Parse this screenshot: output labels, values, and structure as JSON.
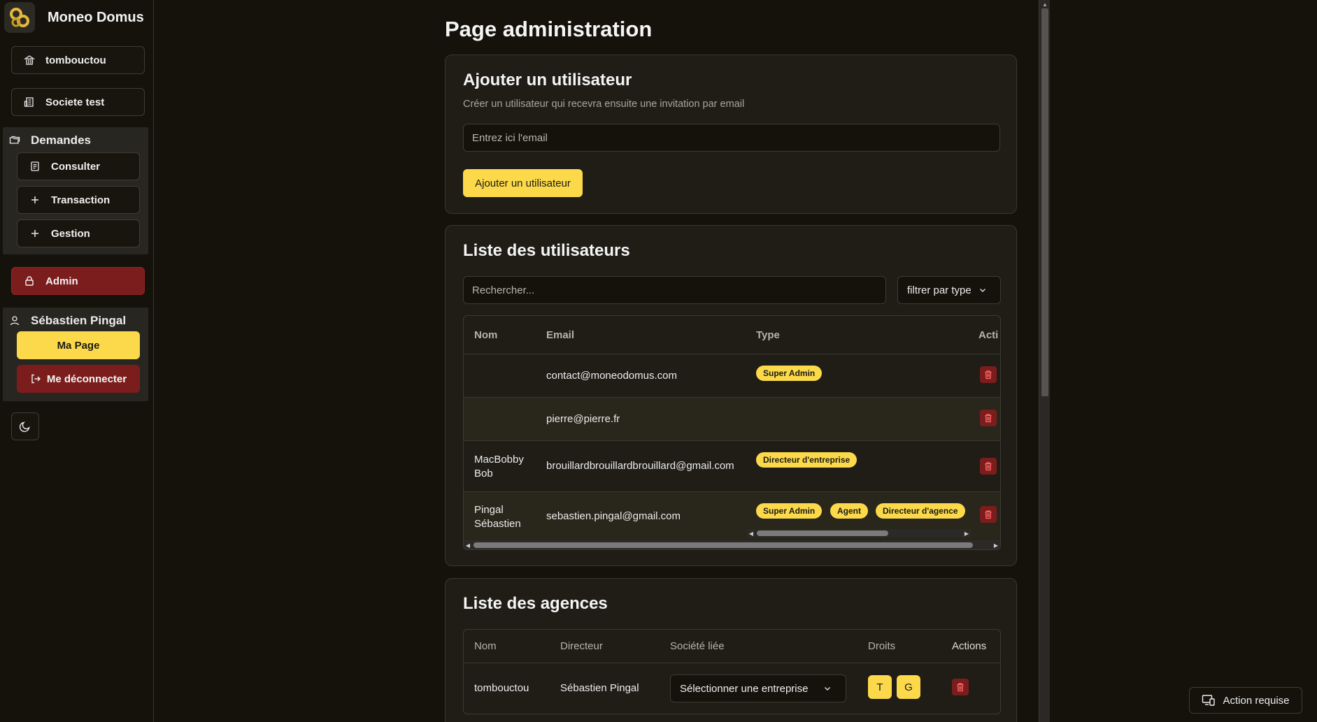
{
  "app": {
    "name": "Moneo Domus"
  },
  "sidebar": {
    "agency": "tombouctou",
    "company": "Societe test",
    "demandes": {
      "title": "Demandes",
      "items": [
        "Consulter",
        "Transaction",
        "Gestion"
      ]
    },
    "admin": "Admin",
    "user": {
      "name": "Sébastien Pingal",
      "my_page": "Ma Page",
      "logout": "Me déconnecter"
    }
  },
  "page": {
    "title": "Page administration"
  },
  "add_user": {
    "title": "Ajouter un utilisateur",
    "subtitle": "Créer un utilisateur qui recevra ensuite une invitation par email",
    "email_placeholder": "Entrez ici l'email",
    "button": "Ajouter un utilisateur"
  },
  "users": {
    "title": "Liste des utilisateurs",
    "search_placeholder": "Rechercher...",
    "filter": "filtrer par type",
    "columns": [
      "Nom",
      "Email",
      "Type",
      "Acti"
    ],
    "rows": [
      {
        "name": "",
        "email": "contact@moneodomus.com",
        "types": [
          "Super Admin"
        ]
      },
      {
        "name": "",
        "email": "pierre@pierre.fr",
        "types": []
      },
      {
        "name": "MacBobby Bob",
        "name_l1": "MacBobby",
        "name_l2": "Bob",
        "email": "brouillardbrouillardbrouillard@gmail.com",
        "types": [
          "Directeur d'entreprise"
        ]
      },
      {
        "name": "Pingal Sébastien",
        "name_l1": "Pingal",
        "name_l2": "Sébastien",
        "email": "sebastien.pingal@gmail.com",
        "types": [
          "Super Admin",
          "Agent",
          "Directeur d'agence"
        ]
      }
    ]
  },
  "agencies": {
    "title": "Liste des agences",
    "columns": [
      "Nom",
      "Directeur",
      "Société liée",
      "Droits",
      "Actions"
    ],
    "rows": [
      {
        "name": "tombouctou",
        "director": "Sébastien Pingal",
        "company_select": "Sélectionner une entreprise",
        "rights": [
          "T",
          "G"
        ]
      }
    ]
  },
  "action_required": "Action requise",
  "icons": {
    "agency": "bank-icon",
    "company": "building-icon",
    "demandes": "folders-icon",
    "consulter": "scroll-icon",
    "transaction": "plus-icon",
    "gestion": "plus-icon",
    "admin": "lock-icon",
    "user": "user-icon",
    "logout": "logout-icon",
    "theme": "moon-icon",
    "delete": "trash-icon",
    "chevron": "chevron-down-icon",
    "action": "devices-icon"
  },
  "colors": {
    "background": "#14120b",
    "card": "#1f1d16",
    "accent_yellow": "#fcd94a",
    "danger_red": "#7c1d1d"
  }
}
